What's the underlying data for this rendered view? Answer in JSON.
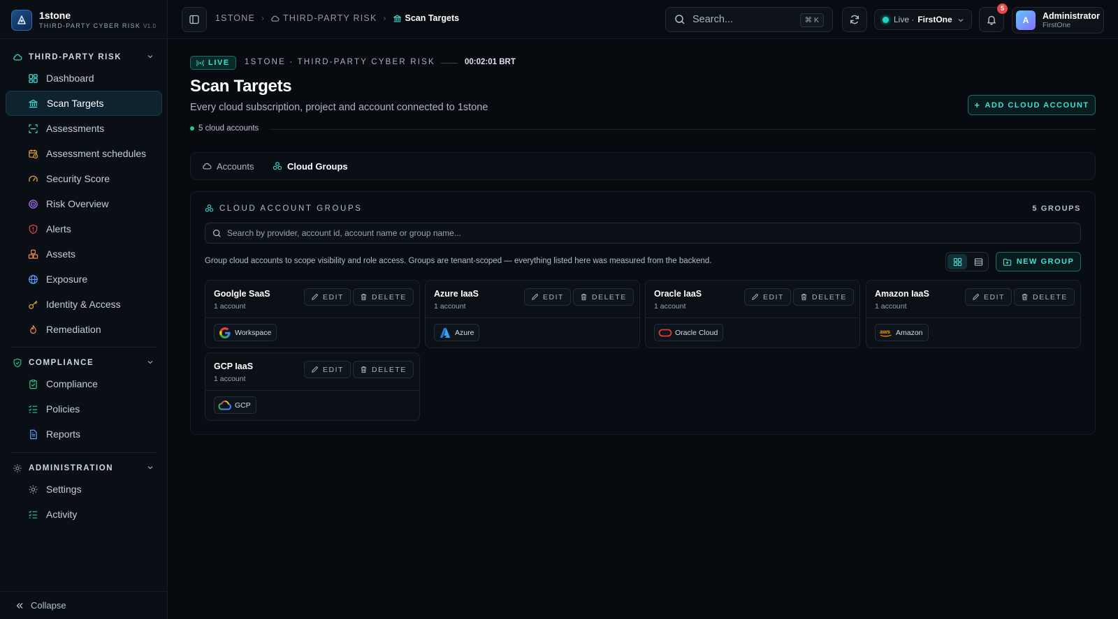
{
  "brand": {
    "name": "1stone",
    "subtitle": "THIRD-PARTY CYBER RISK",
    "version": "V1.0"
  },
  "sidebar": {
    "sections": [
      {
        "label": "THIRD-PARTY RISK"
      },
      {
        "label": "COMPLIANCE"
      },
      {
        "label": "ADMINISTRATION"
      }
    ],
    "items": [
      {
        "label": "Dashboard",
        "icon": "dashboard-icon"
      },
      {
        "label": "Scan Targets",
        "icon": "bank-icon",
        "active": true
      },
      {
        "label": "Assessments",
        "icon": "scan-icon"
      },
      {
        "label": "Assessment schedules",
        "icon": "calendar-clock-icon"
      },
      {
        "label": "Security Score",
        "icon": "gauge-icon"
      },
      {
        "label": "Risk Overview",
        "icon": "radar-icon"
      },
      {
        "label": "Alerts",
        "icon": "shield-alert-icon"
      },
      {
        "label": "Assets",
        "icon": "boxes-icon"
      },
      {
        "label": "Exposure",
        "icon": "globe-icon"
      },
      {
        "label": "Identity & Access",
        "icon": "key-icon"
      },
      {
        "label": "Remediation",
        "icon": "flame-icon"
      },
      {
        "label": "Compliance",
        "icon": "clipboard-check-icon"
      },
      {
        "label": "Policies",
        "icon": "list-check-icon"
      },
      {
        "label": "Reports",
        "icon": "file-text-icon"
      },
      {
        "label": "Settings",
        "icon": "gear-icon"
      },
      {
        "label": "Activity",
        "icon": "activity-list-icon"
      }
    ],
    "collapse_label": "Collapse"
  },
  "topbar": {
    "breadcrumb": [
      "1STONE",
      "THIRD-PARTY RISK",
      "Scan Targets"
    ],
    "search_placeholder": "Search...",
    "search_shortcut": "⌘ K",
    "live_label": "Live ·",
    "org": "FirstOne",
    "notifications_count": "5",
    "user": {
      "initial": "A",
      "name": "Administrator",
      "org": "FirstOne"
    }
  },
  "main": {
    "live_tag": "LIVE",
    "org_line": "1STONE · THIRD-PARTY CYBER RISK",
    "clock": "00:02:01 BRT",
    "title": "Scan Targets",
    "subtitle": "Every cloud subscription, project and account connected to 1stone",
    "count": "5 cloud accounts",
    "add_button": "ADD CLOUD ACCOUNT",
    "tabs": [
      {
        "label": "Accounts",
        "active": false
      },
      {
        "label": "Cloud Groups",
        "active": true
      }
    ]
  },
  "groups_panel": {
    "title": "CLOUD ACCOUNT GROUPS",
    "count": "5 GROUPS",
    "search_placeholder": "Search by provider, account id, account name or group name...",
    "description": "Group cloud accounts to scope visibility and role access. Groups are tenant-scoped — everything listed here was measured from the backend.",
    "new_group": "NEW GROUP",
    "edit_label": "EDIT",
    "delete_label": "DELETE",
    "groups": [
      {
        "name": "Goolgle SaaS",
        "count": "1 account",
        "provider": "Workspace",
        "logo": "google-logo-icon"
      },
      {
        "name": "Azure IaaS",
        "count": "1 account",
        "provider": "Azure",
        "logo": "azure-logo-icon"
      },
      {
        "name": "Oracle IaaS",
        "count": "1 account",
        "provider": "Oracle Cloud",
        "logo": "oracle-logo-icon"
      },
      {
        "name": "Amazon IaaS",
        "count": "1 account",
        "provider": "Amazon",
        "logo": "aws-logo-icon"
      },
      {
        "name": "GCP IaaS",
        "count": "1 account",
        "provider": "GCP",
        "logo": "gcp-logo-icon"
      }
    ]
  },
  "colors": {
    "accent": "#3fe0d0",
    "background": "#070b10",
    "badge": "#e5484d"
  }
}
